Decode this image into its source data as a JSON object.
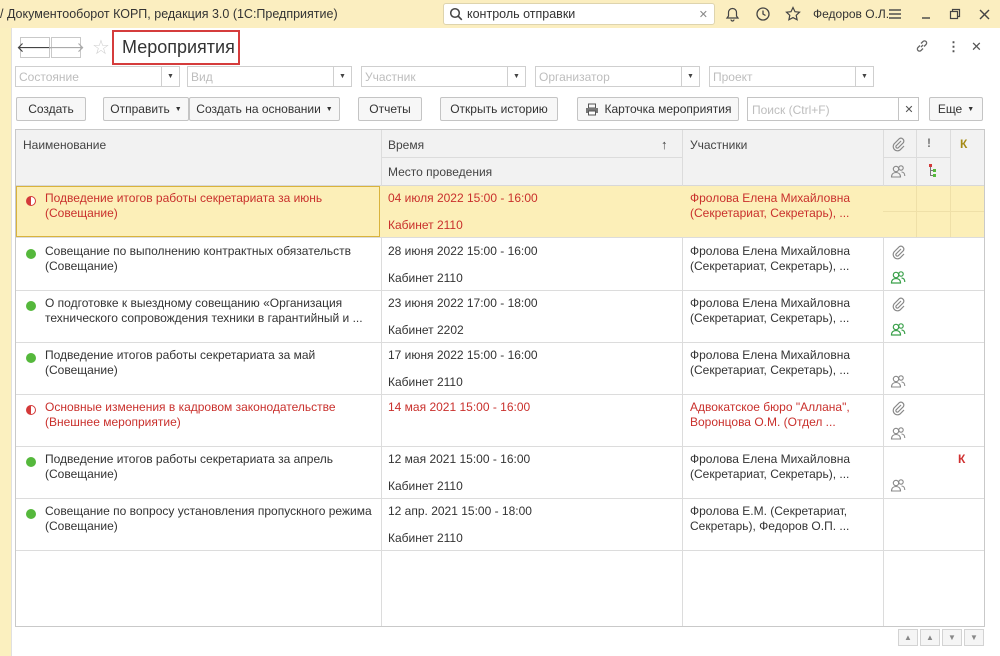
{
  "app": {
    "title": "Документооборот КОРП, редакция 3.0  (1С:Предприятие)",
    "search_value": "контроль отправки",
    "user": "Федоров О.Л."
  },
  "window": {
    "title": "Мероприятия"
  },
  "filters": {
    "state": "Состояние",
    "kind": "Вид",
    "participant": "Участник",
    "organizer": "Организатор",
    "project": "Проект"
  },
  "toolbar": {
    "create": "Создать",
    "send": "Отправить",
    "create_based": "Создать на основании",
    "reports": "Отчеты",
    "open_history": "Открыть историю",
    "event_card": "Карточка мероприятия",
    "search_placeholder": "Поиск (Ctrl+F)",
    "more": "Еще"
  },
  "table": {
    "columns": {
      "name": "Наименование",
      "time": "Время",
      "place": "Место проведения",
      "participants": "Участники",
      "k": "К"
    },
    "rows": [
      {
        "status": "overdue",
        "name": "Подведение итогов работы секретариата за июнь (Совещание)",
        "time": "04 июля 2022 15:00 - 16:00",
        "place": "Кабинет 2110",
        "participants": "Фролова Елена Михайловна (Секретариат, Секретарь), ...",
        "attachment": false,
        "participants_icon": false,
        "k": "",
        "red": true
      },
      {
        "status": "done",
        "name": "Совещание по выполнению контрактных обязательств (Совещание)",
        "time": "28 июня 2022 15:00 - 16:00",
        "place": "Кабинет 2110",
        "participants": "Фролова Елена Михайловна (Секретариат, Секретарь), ...",
        "attachment": true,
        "participants_icon": "green",
        "k": ""
      },
      {
        "status": "done",
        "name": "О подготовке к выездному совещанию «Организация технического сопровождения техники в гарантийный и ...",
        "time": "23 июня 2022 17:00 - 18:00",
        "place": "Кабинет 2202",
        "participants": "Фролова Елена Михайловна (Секретариат, Секретарь), ...",
        "attachment": true,
        "participants_icon": "green",
        "k": ""
      },
      {
        "status": "done",
        "name": "Подведение итогов работы секретариата за май (Совещание)",
        "time": "17 июня 2022 15:00 - 16:00",
        "place": "Кабинет 2110",
        "participants": "Фролова Елена Михайловна (Секретариат, Секретарь), ...",
        "attachment": false,
        "participants_icon": "gray",
        "k": ""
      },
      {
        "status": "overdue",
        "name": "Основные изменения в кадровом законодательстве (Внешнее мероприятие)",
        "time": "14 мая 2021 15:00 - 16:00",
        "place": "",
        "participants": "Адвокатское бюро \"Аллана\", Воронцова О.М. (Отдел ...",
        "attachment": true,
        "participants_icon": "gray",
        "k": "",
        "red": true
      },
      {
        "status": "done",
        "name": "Подведение итогов работы секретариата за апрель (Совещание)",
        "time": "12 мая 2021 15:00 - 16:00",
        "place": "Кабинет 2110",
        "participants": "Фролова Елена Михайловна (Секретариат, Секретарь), ...",
        "attachment": false,
        "participants_icon": "gray",
        "k": "К"
      },
      {
        "status": "done",
        "name": "Совещание по вопросу установления пропускного режима (Совещание)",
        "time": "12 апр. 2021 15:00 - 18:00",
        "place": "Кабинет 2110",
        "participants": "Фролова Е.М. (Секретариат, Секретарь), Федоров О.П. ...",
        "attachment": false,
        "participants_icon": false,
        "k": ""
      }
    ]
  },
  "colors": {
    "accent_red": "#d53c3c",
    "status_green": "#55b83c",
    "selection": "#fcefb8",
    "topbar": "#fbeec0"
  },
  "icons": [
    "search-icon",
    "bell-icon",
    "history-icon",
    "star-icon",
    "menu-icon",
    "restore-icon",
    "close-icon",
    "link-icon",
    "more-icon",
    "printer-icon",
    "paperclip-icon",
    "participants-icon",
    "importance-icon",
    "tree-icon"
  ]
}
